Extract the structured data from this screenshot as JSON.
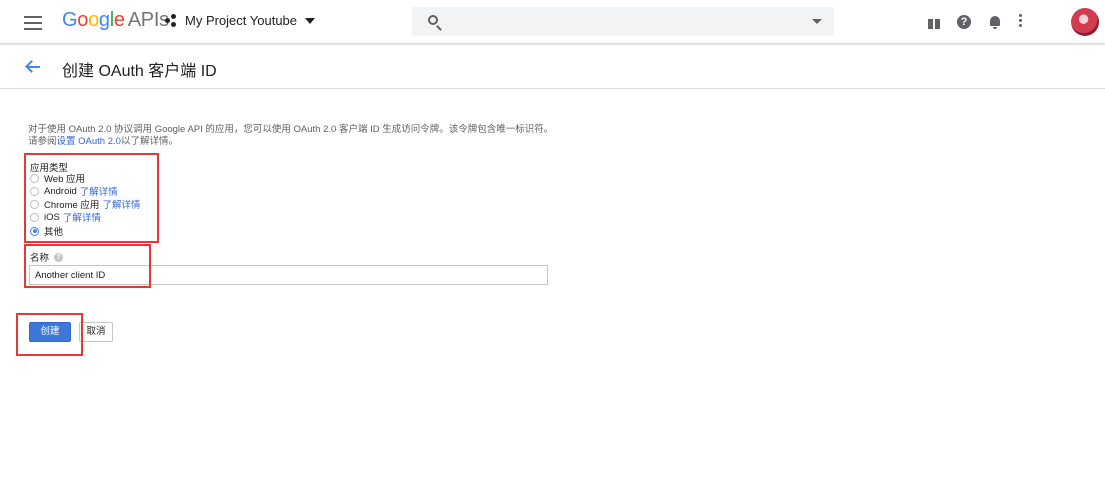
{
  "header": {
    "logo_google": [
      "G",
      "o",
      "o",
      "g",
      "l",
      "e"
    ],
    "logo_apis": "APIs",
    "project_name": "My Project Youtube",
    "search_placeholder": "",
    "help_glyph": "?"
  },
  "subheader": {
    "title": "创建 OAuth 客户端 ID"
  },
  "form": {
    "description_part1": "对于使用 OAuth 2.0 协议调用 Google API 的应用，您可以使用 OAuth 2.0 客户端 ID 生成访问令牌。该令牌包含唯一标识符。请参阅",
    "description_link": "设置 OAuth 2.0",
    "description_part2": "以了解详情。",
    "app_type_label": "应用类型",
    "app_types": [
      {
        "label": "Web 应用",
        "link": "",
        "checked": false
      },
      {
        "label": "Android",
        "link": "了解详情",
        "checked": false
      },
      {
        "label": "Chrome 应用",
        "link": "了解详情",
        "checked": false
      },
      {
        "label": "iOS",
        "link": "了解详情",
        "checked": false
      },
      {
        "label": "其他",
        "link": "",
        "checked": true
      }
    ],
    "name_label": "名称",
    "name_help_glyph": "?",
    "name_value": "Another client ID",
    "create_label": "创建",
    "cancel_label": "取消"
  },
  "colors": {
    "accent": "#4285f4",
    "link": "#3367d6",
    "highlight": "#e53935"
  }
}
